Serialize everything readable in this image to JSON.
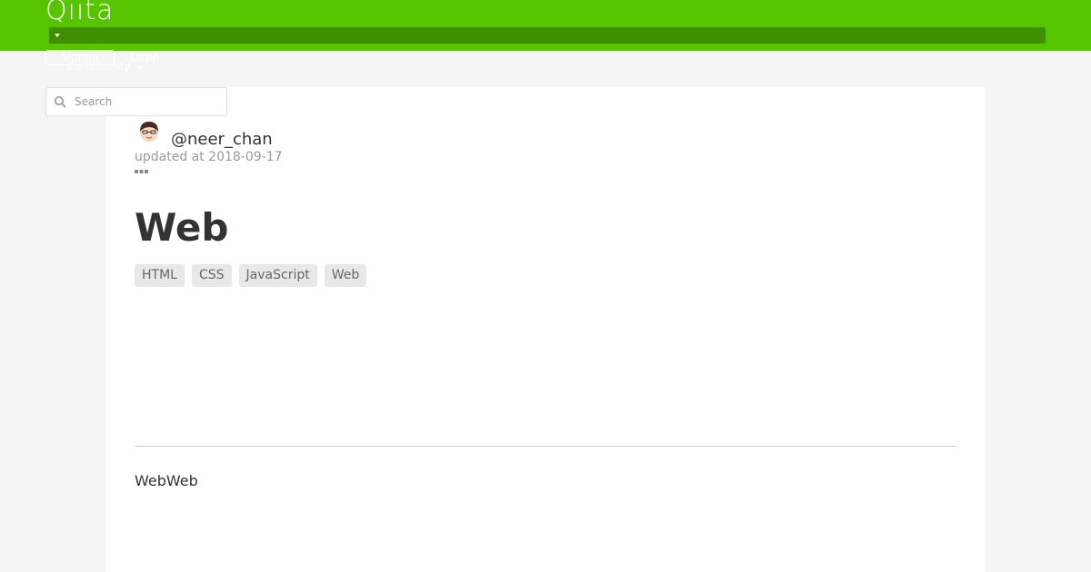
{
  "header": {
    "logo": "Qiita",
    "signup_label": "Signup",
    "login_label": "Login",
    "community_label": "Community",
    "brand_color": "#55c500",
    "bar_color": "#3f8f00"
  },
  "search": {
    "placeholder": "Search",
    "icon": "search-icon"
  },
  "article": {
    "author": "@neer_chan",
    "updated": "updated at 2018-09-17",
    "title": "Web",
    "tags": [
      "HTML",
      "CSS",
      "JavaScript",
      "Web"
    ],
    "body": "WebWeb"
  }
}
